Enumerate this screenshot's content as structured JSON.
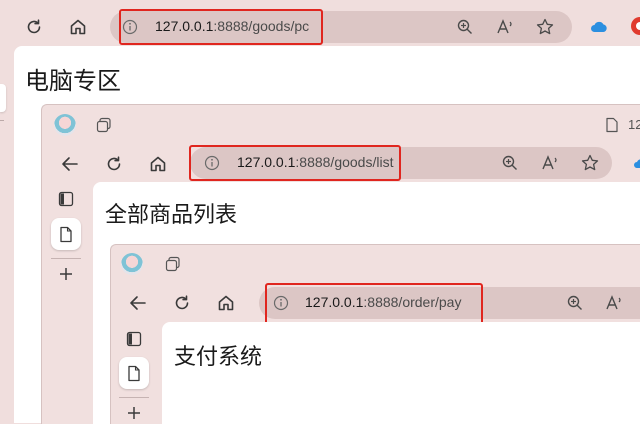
{
  "outer": {
    "address": {
      "host": "127.0.0.1",
      "rest": ":8888/goods/pc"
    },
    "page_heading": "电脑专区"
  },
  "middle": {
    "tab_label_fragment": "12",
    "address": {
      "host": "127.0.0.1",
      "rest": ":8888/goods/list"
    },
    "page_heading": "全部商品列表"
  },
  "inner": {
    "address": {
      "host": "127.0.0.1",
      "rest": ":8888/order/pay"
    },
    "page_heading": "支付系统"
  },
  "colors": {
    "highlight_box": "#e0261f",
    "window_background": "#f0dedd",
    "address_bar": "#dcc6c5",
    "page_background": "#ffffff"
  }
}
